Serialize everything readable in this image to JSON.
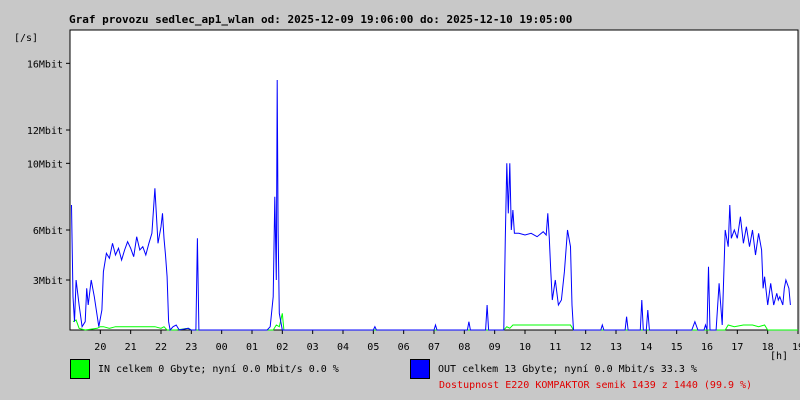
{
  "chart_data": {
    "type": "line",
    "title": "Graf provozu sedlec_ap1_wlan od: 2025-12-09 19:06:00 do: 2025-12-10 19:05:00",
    "ylabel": "[/s]",
    "xlabel": "[h]",
    "y_ticks": [
      "3Mbit",
      "6Mbit",
      "10Mbit",
      "12Mbit",
      "16Mbit"
    ],
    "x_ticks": [
      "20",
      "21",
      "22",
      "23",
      "00",
      "01",
      "02",
      "03",
      "04",
      "05",
      "06",
      "07",
      "08",
      "09",
      "10",
      "11",
      "12",
      "13",
      "14",
      "15",
      "16",
      "17",
      "18",
      "19"
    ],
    "ylim": [
      0,
      18
    ],
    "series": [
      {
        "name": "IN",
        "color": "#00ff00",
        "points": [
          [
            19.1,
            0.5
          ],
          [
            19.2,
            0.6
          ],
          [
            19.3,
            0.1
          ],
          [
            19.5,
            0.0
          ],
          [
            19.9,
            0.1
          ],
          [
            20.0,
            0.2
          ],
          [
            20.1,
            0.2
          ],
          [
            20.3,
            0.1
          ],
          [
            20.5,
            0.2
          ],
          [
            20.8,
            0.2
          ],
          [
            21.0,
            0.2
          ],
          [
            21.3,
            0.2
          ],
          [
            21.5,
            0.2
          ],
          [
            21.8,
            0.2
          ],
          [
            22.0,
            0.1
          ],
          [
            22.1,
            0.2
          ],
          [
            22.2,
            0.0
          ],
          [
            22.5,
            0.0
          ],
          [
            22.9,
            0.1
          ],
          [
            23.0,
            0.0
          ],
          [
            25.7,
            0.0
          ],
          [
            25.8,
            0.3
          ],
          [
            25.9,
            0.2
          ],
          [
            26.0,
            1.0
          ],
          [
            26.05,
            0.0
          ],
          [
            33.3,
            0.0
          ],
          [
            33.4,
            0.2
          ],
          [
            33.5,
            0.1
          ],
          [
            33.6,
            0.3
          ],
          [
            33.8,
            0.3
          ],
          [
            34.0,
            0.3
          ],
          [
            34.3,
            0.3
          ],
          [
            34.6,
            0.3
          ],
          [
            34.9,
            0.3
          ],
          [
            35.2,
            0.3
          ],
          [
            35.5,
            0.3
          ],
          [
            35.6,
            0.0
          ],
          [
            40.6,
            0.0
          ],
          [
            40.7,
            0.3
          ],
          [
            40.9,
            0.2
          ],
          [
            41.2,
            0.3
          ],
          [
            41.5,
            0.3
          ],
          [
            41.7,
            0.2
          ],
          [
            41.9,
            0.3
          ],
          [
            42.0,
            0.0
          ],
          [
            43.0,
            0.0
          ]
        ]
      },
      {
        "name": "OUT",
        "color": "#0000ff",
        "points": [
          [
            19.05,
            7.5
          ],
          [
            19.1,
            2.0
          ],
          [
            19.15,
            0.5
          ],
          [
            19.2,
            3.0
          ],
          [
            19.3,
            1.5
          ],
          [
            19.4,
            0.2
          ],
          [
            19.5,
            0.5
          ],
          [
            19.55,
            2.5
          ],
          [
            19.6,
            1.5
          ],
          [
            19.7,
            3.0
          ],
          [
            19.8,
            2.0
          ],
          [
            19.9,
            0.8
          ],
          [
            19.95,
            0.2
          ],
          [
            20.05,
            1.2
          ],
          [
            20.1,
            3.5
          ],
          [
            20.2,
            4.6
          ],
          [
            20.3,
            4.3
          ],
          [
            20.4,
            5.2
          ],
          [
            20.5,
            4.5
          ],
          [
            20.6,
            4.9
          ],
          [
            20.7,
            4.2
          ],
          [
            20.8,
            4.8
          ],
          [
            20.9,
            5.3
          ],
          [
            21.0,
            4.9
          ],
          [
            21.1,
            4.4
          ],
          [
            21.2,
            5.6
          ],
          [
            21.3,
            4.8
          ],
          [
            21.4,
            5.0
          ],
          [
            21.5,
            4.5
          ],
          [
            21.6,
            5.2
          ],
          [
            21.7,
            5.8
          ],
          [
            21.8,
            8.5
          ],
          [
            21.9,
            5.2
          ],
          [
            22.0,
            6.2
          ],
          [
            22.05,
            7.0
          ],
          [
            22.1,
            5.5
          ],
          [
            22.15,
            4.5
          ],
          [
            22.2,
            3.2
          ],
          [
            22.25,
            0.5
          ],
          [
            22.3,
            0.0
          ],
          [
            22.4,
            0.2
          ],
          [
            22.5,
            0.3
          ],
          [
            22.6,
            0.0
          ],
          [
            22.9,
            0.1
          ],
          [
            23.0,
            0.0
          ],
          [
            23.15,
            0.0
          ],
          [
            23.2,
            5.5
          ],
          [
            23.25,
            0.0
          ],
          [
            25.5,
            0.0
          ],
          [
            25.6,
            0.2
          ],
          [
            25.7,
            2.0
          ],
          [
            25.75,
            8.0
          ],
          [
            25.8,
            3.0
          ],
          [
            25.83,
            15.0
          ],
          [
            25.86,
            6.0
          ],
          [
            25.9,
            1.0
          ],
          [
            26.0,
            0.0
          ],
          [
            29.0,
            0.0
          ],
          [
            29.05,
            0.2
          ],
          [
            29.1,
            0.0
          ],
          [
            31.0,
            0.0
          ],
          [
            31.05,
            0.3
          ],
          [
            31.1,
            0.0
          ],
          [
            32.1,
            0.0
          ],
          [
            32.15,
            0.5
          ],
          [
            32.2,
            0.0
          ],
          [
            32.7,
            0.0
          ],
          [
            32.75,
            1.5
          ],
          [
            32.8,
            0.0
          ],
          [
            33.3,
            0.0
          ],
          [
            33.35,
            5.5
          ],
          [
            33.4,
            10.0
          ],
          [
            33.45,
            7.0
          ],
          [
            33.5,
            10.0
          ],
          [
            33.55,
            6.0
          ],
          [
            33.6,
            7.2
          ],
          [
            33.65,
            5.8
          ],
          [
            33.8,
            5.8
          ],
          [
            34.0,
            5.7
          ],
          [
            34.2,
            5.8
          ],
          [
            34.4,
            5.6
          ],
          [
            34.6,
            5.9
          ],
          [
            34.7,
            5.7
          ],
          [
            34.75,
            7.0
          ],
          [
            34.8,
            5.5
          ],
          [
            34.85,
            3.5
          ],
          [
            34.9,
            1.8
          ],
          [
            35.0,
            3.0
          ],
          [
            35.1,
            1.5
          ],
          [
            35.2,
            1.8
          ],
          [
            35.3,
            3.5
          ],
          [
            35.4,
            6.0
          ],
          [
            35.5,
            5.0
          ],
          [
            35.55,
            1.5
          ],
          [
            35.6,
            0.0
          ],
          [
            36.5,
            0.0
          ],
          [
            36.55,
            0.3
          ],
          [
            36.6,
            0.0
          ],
          [
            37.3,
            0.0
          ],
          [
            37.35,
            0.8
          ],
          [
            37.4,
            0.0
          ],
          [
            37.8,
            0.0
          ],
          [
            37.85,
            1.8
          ],
          [
            37.9,
            0.0
          ],
          [
            38.0,
            0.0
          ],
          [
            38.05,
            1.2
          ],
          [
            38.1,
            0.0
          ],
          [
            39.5,
            0.0
          ],
          [
            39.6,
            0.5
          ],
          [
            39.7,
            0.0
          ],
          [
            39.9,
            0.0
          ],
          [
            39.95,
            0.3
          ],
          [
            40.0,
            0.0
          ],
          [
            40.05,
            3.8
          ],
          [
            40.1,
            0.0
          ],
          [
            40.3,
            0.0
          ],
          [
            40.4,
            2.8
          ],
          [
            40.5,
            0.3
          ],
          [
            40.6,
            6.0
          ],
          [
            40.7,
            5.0
          ],
          [
            40.75,
            7.5
          ],
          [
            40.8,
            5.5
          ],
          [
            40.9,
            6.0
          ],
          [
            41.0,
            5.5
          ],
          [
            41.1,
            6.8
          ],
          [
            41.2,
            5.2
          ],
          [
            41.3,
            6.2
          ],
          [
            41.4,
            5.0
          ],
          [
            41.5,
            6.0
          ],
          [
            41.6,
            4.5
          ],
          [
            41.7,
            5.8
          ],
          [
            41.8,
            4.8
          ],
          [
            41.85,
            2.5
          ],
          [
            41.9,
            3.2
          ],
          [
            42.0,
            1.5
          ],
          [
            42.1,
            2.8
          ],
          [
            42.2,
            1.5
          ],
          [
            42.3,
            2.2
          ],
          [
            42.35,
            1.8
          ],
          [
            42.4,
            2.0
          ],
          [
            42.5,
            1.5
          ],
          [
            42.55,
            2.5
          ],
          [
            42.6,
            3.0
          ],
          [
            42.7,
            2.5
          ],
          [
            42.75,
            1.5
          ]
        ]
      }
    ],
    "legend": [
      {
        "name": "IN",
        "text": "IN celkem 0 Gbyte; nyní   0.0 Mbit/s 0.0 %",
        "color": "#00ff00"
      },
      {
        "name": "OUT",
        "text": "OUT celkem 13 Gbyte; nyní   0.0 Mbit/s 33.3 %",
        "color": "#0000ff"
      }
    ],
    "availability": "Dostupnost E220 KOMPAKTOR semik 1439 z 1440 (99.9 %)",
    "grid": false
  }
}
